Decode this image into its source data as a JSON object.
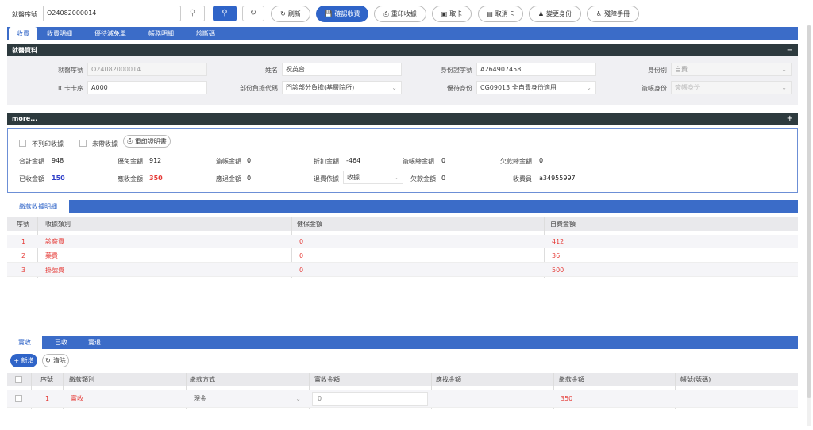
{
  "toolbar": {
    "visit_label": "就醫序號",
    "visit_value": "O24082000014",
    "refresh_label": "刷新",
    "confirm_label": "確認收費",
    "reprint_label": "重印收據",
    "take_card_label": "取卡",
    "cancel_card_label": "取消卡",
    "change_identity_label": "變更身份",
    "disability_label": "殘障手冊"
  },
  "main_tabs": [
    "收費",
    "收費明細",
    "優待減免單",
    "帳務明細",
    "診斷碼"
  ],
  "visit_info": {
    "title": "就醫資料",
    "collapse": "−",
    "visit_no_label": "就醫序號",
    "visit_no": "O24082000014",
    "name_label": "姓名",
    "name": "祝英台",
    "id_label": "身份證字號",
    "id_no": "A264907458",
    "identity_label": "身份別",
    "identity": "自費",
    "ic_label": "IC卡卡序",
    "ic_value": "A000",
    "copay_label": "部份負擔代碼",
    "copay_value": "門診部分負擔(基層院所)",
    "priority_label": "優待身份",
    "priority_value": "CG09013:全自費身份適用",
    "contract_label": "簽帳身份",
    "contract_placeholder": "簽帳身份"
  },
  "more": {
    "title": "more...",
    "expand": "+",
    "no_print_label": "不列印收據",
    "no_bring_label": "未帶收據",
    "reprint_cert_label": "重印證明書",
    "total_label": "合計金額",
    "total": "948",
    "exempt_label": "優免金額",
    "exempt": "912",
    "contract_amt_label": "簽帳金額",
    "contract_amt": "0",
    "discount_label": "折扣金額",
    "discount": "-464",
    "contract_total_label": "簽帳總金額",
    "contract_total": "0",
    "owe_total_label": "欠款總金額",
    "owe_total": "0",
    "received_label": "已收金額",
    "received": "150",
    "due_label": "應收金額",
    "due": "350",
    "refund_label": "應退金額",
    "refund": "0",
    "refund_basis_label": "退費依據",
    "refund_basis": "收據",
    "owe_label": "欠款金額",
    "owe": "0",
    "cashier_label": "收費員",
    "cashier": "a34955997"
  },
  "receipt_detail": {
    "tab": "繳款收據明細",
    "columns": [
      "序號",
      "收據類別",
      "健保金額",
      "自費金額"
    ],
    "rows": [
      {
        "no": "1",
        "type": "診察費",
        "nhi": "0",
        "self": "412"
      },
      {
        "no": "2",
        "type": "藥費",
        "nhi": "0",
        "self": "36"
      },
      {
        "no": "3",
        "type": "掛號費",
        "nhi": "0",
        "self": "500"
      }
    ]
  },
  "payment": {
    "tabs": [
      "實收",
      "已收",
      "實退"
    ],
    "add_label": "+ 新增",
    "clear_label": "清除",
    "columns": [
      "序號",
      "繳款類別",
      "繳款方式",
      "實收金額",
      "應找金額",
      "繳款金額",
      "帳號(號碼)"
    ],
    "rows": [
      {
        "no": "1",
        "type": "實收",
        "method": "現金",
        "actual": "0",
        "change": "",
        "amount": "350",
        "account": ""
      }
    ]
  }
}
